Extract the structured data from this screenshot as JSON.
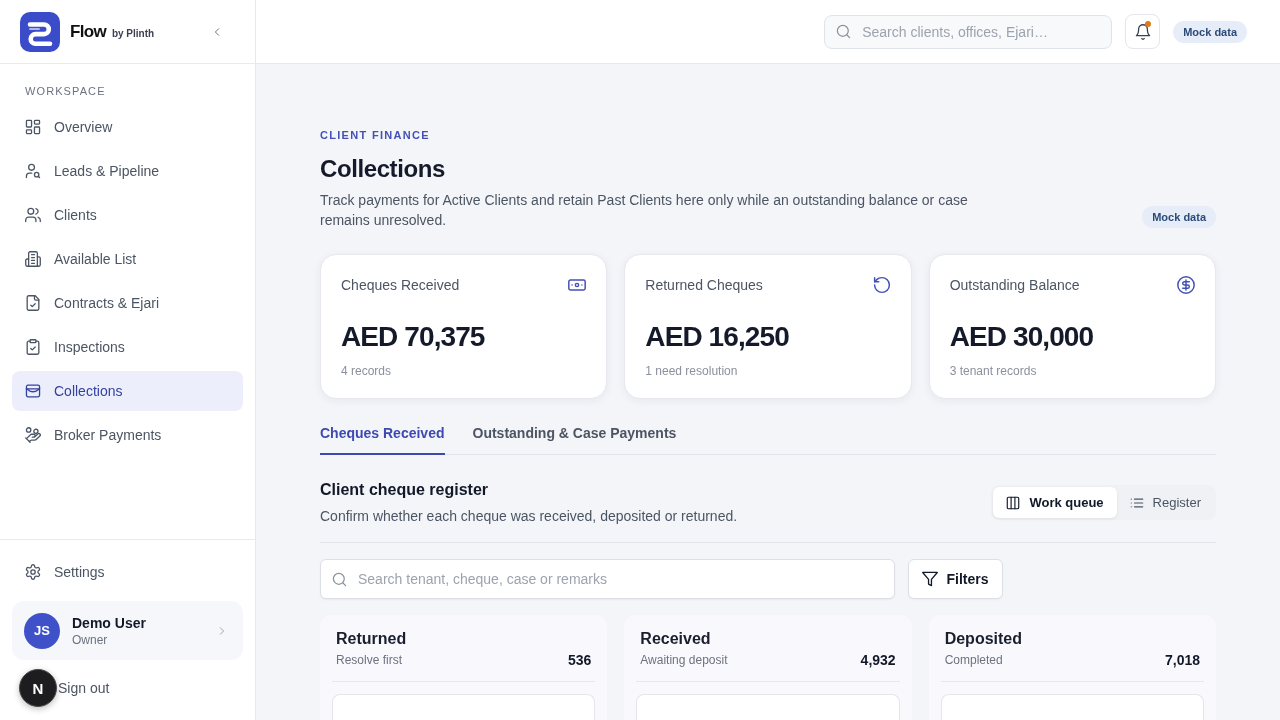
{
  "sidebar": {
    "brand": {
      "name": "Flow",
      "tagline": "by Plinth"
    },
    "section_label": "WORKSPACE",
    "items": [
      {
        "label": "Overview",
        "selected": false
      },
      {
        "label": "Leads & Pipeline",
        "selected": false
      },
      {
        "label": "Clients",
        "selected": false
      },
      {
        "label": "Available List",
        "selected": false
      },
      {
        "label": "Contracts & Ejari",
        "selected": false
      },
      {
        "label": "Inspections",
        "selected": false
      },
      {
        "label": "Collections",
        "selected": true
      },
      {
        "label": "Broker Payments",
        "selected": false
      }
    ],
    "settings": "Settings",
    "user": {
      "initials": "JS",
      "name": "Demo User",
      "role": "Owner"
    },
    "sign_out": "Sign out"
  },
  "topbar": {
    "search": {
      "placeholder": "Search clients, offices, Ejari…"
    },
    "notifications": {
      "unread": true
    },
    "badge": "Mock data"
  },
  "header": {
    "eyebrow": "CLIENT FINANCE",
    "title": "Collections",
    "description": "Track payments for Active Clients and retain Past Clients here only while an outstanding balance or case remains unresolved.",
    "badge": "Mock data"
  },
  "stats": [
    {
      "label": "Cheques Received",
      "value": "AED 70,375",
      "note": "4 records"
    },
    {
      "label": "Returned Cheques",
      "value": "AED 16,250",
      "note": "1 need resolution"
    },
    {
      "label": "Outstanding Balance",
      "value": "AED 30,000",
      "note": "3 tenant records"
    }
  ],
  "tabs": [
    {
      "label": "Cheques Received",
      "selected": true
    },
    {
      "label": "Outstanding & Case Payments",
      "selected": false
    }
  ],
  "register": {
    "title": "Client cheque register",
    "subtitle": "Confirm whether each cheque was received, deposited or returned.",
    "views": [
      {
        "label": "Work queue",
        "selected": true
      },
      {
        "label": "Register",
        "selected": false
      }
    ],
    "search": {
      "placeholder": "Search tenant, cheque, case or remarks"
    },
    "filters": "Filters",
    "columns": [
      {
        "title": "Returned",
        "subtitle": "Resolve first",
        "count": "536"
      },
      {
        "title": "Received",
        "subtitle": "Awaiting deposit",
        "count": "4,932"
      },
      {
        "title": "Deposited",
        "subtitle": "Completed",
        "count": "7,018"
      }
    ]
  },
  "dev_badge": "N"
}
